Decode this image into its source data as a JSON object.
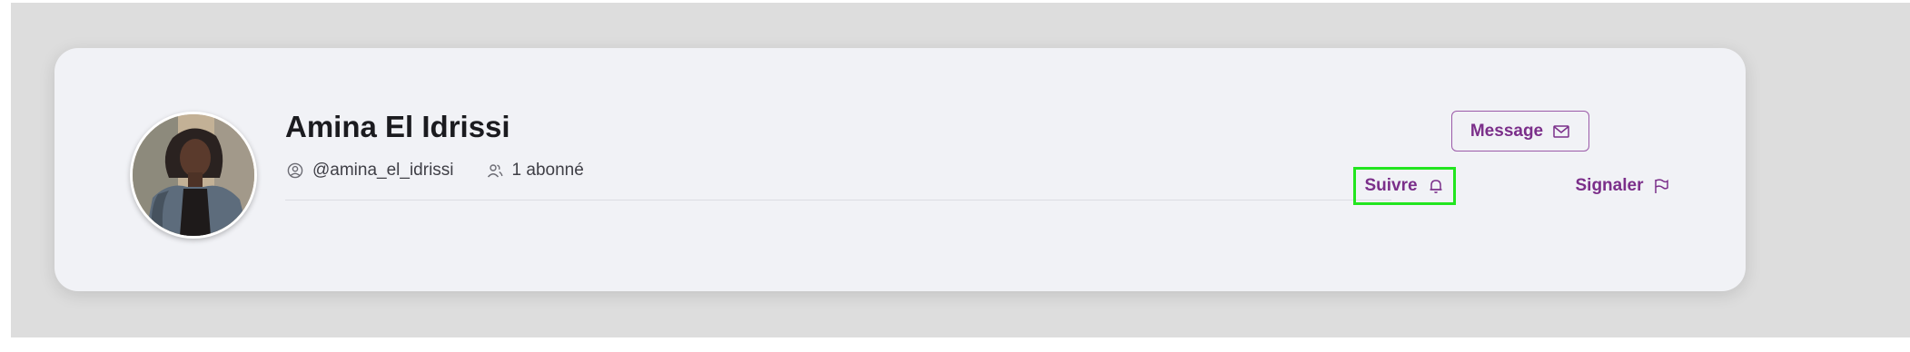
{
  "profile": {
    "name": "Amina El Idrissi",
    "username": "@amina_el_idrissi",
    "followers": "1 abonné",
    "avatar_icon": "user-photo"
  },
  "actions": {
    "message_label": "Message",
    "message_icon": "envelope-icon",
    "follow_label": "Suivre",
    "follow_icon": "bell-icon",
    "report_label": "Signaler",
    "report_icon": "flag-icon"
  },
  "colors": {
    "accent": "#7b2f8a",
    "highlight": "#22e51f",
    "card": "#f1f2f6",
    "backdrop": "#dddddd"
  }
}
